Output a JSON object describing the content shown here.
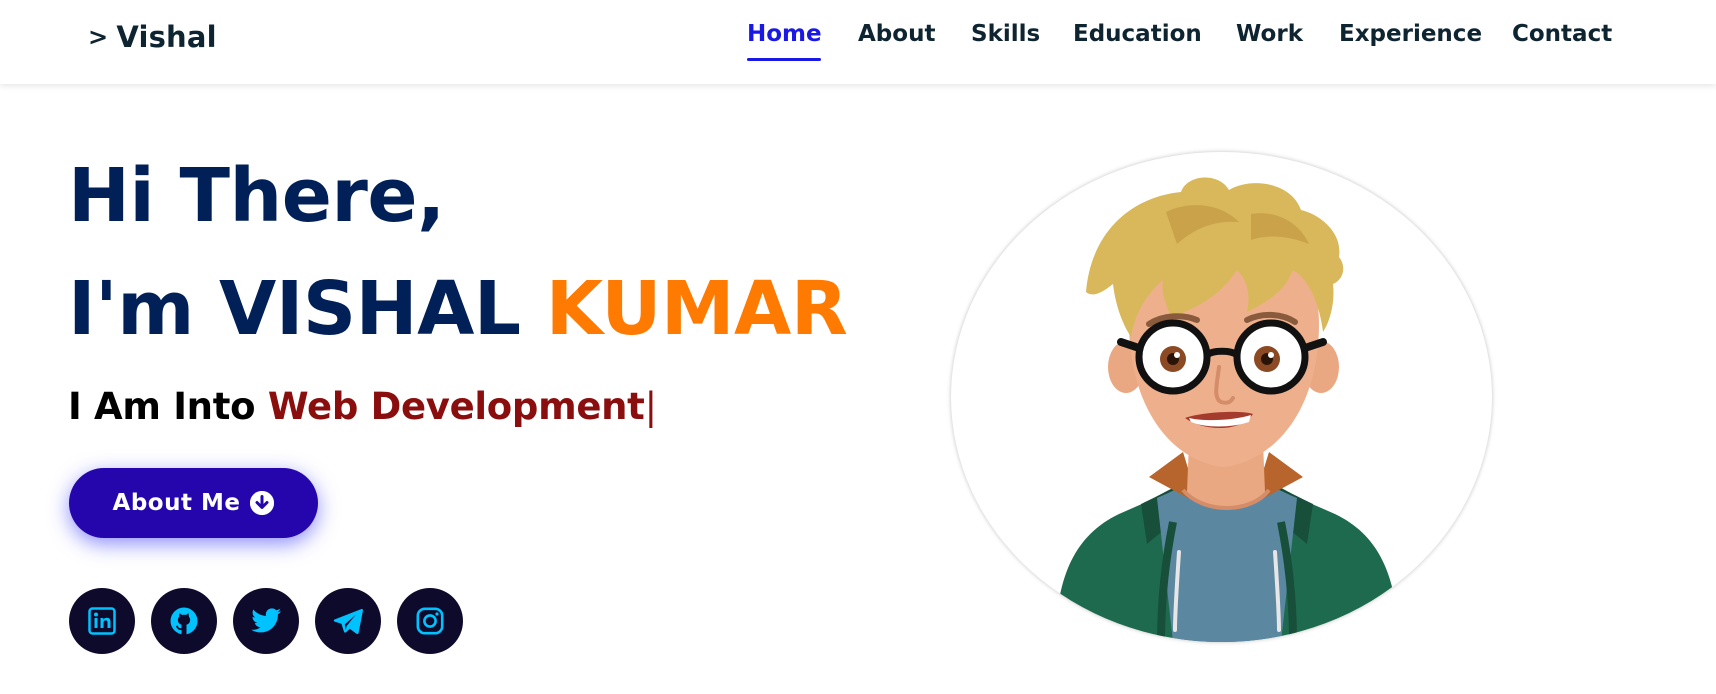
{
  "nav": {
    "brand": "Vishal",
    "links": [
      "Home",
      "About",
      "Skills",
      "Education",
      "Work",
      "Experience",
      "Contact"
    ],
    "active": "Home"
  },
  "hero": {
    "greeting": "Hi There,",
    "intro_prefix": "I'm VISHAL",
    "intro_accent": "KUMAR",
    "tagline_prefix": "I Am Into",
    "tagline_typed": "Web Development",
    "cursor": "|",
    "button_label": "About Me"
  },
  "social_icons": [
    "linkedin-icon",
    "github-icon",
    "twitter-icon",
    "telegram-icon",
    "instagram-icon"
  ],
  "colors": {
    "accent_orange": "#ff7a00",
    "heading_navy": "#002057",
    "nav_active": "#1a18e4",
    "button_bg": "#2506ad",
    "typed_text": "#8a0e0e",
    "social_icon": "#00c2ff"
  }
}
